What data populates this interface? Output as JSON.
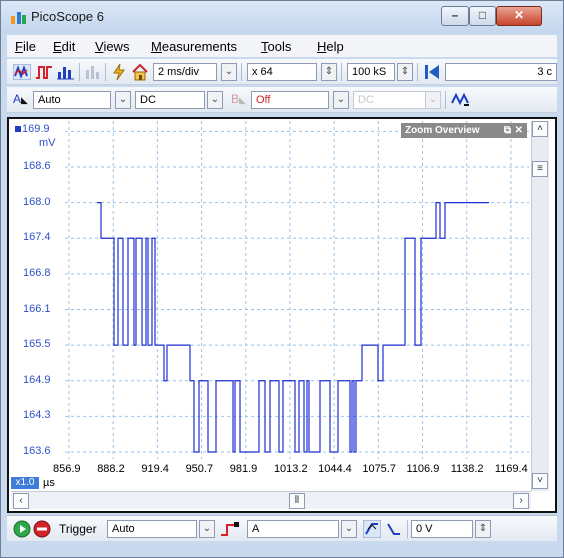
{
  "window": {
    "title": "PicoScope 6"
  },
  "menu": [
    {
      "label": "File",
      "key": "F",
      "rest": "ile"
    },
    {
      "label": "Edit",
      "key": "E",
      "rest": "dit"
    },
    {
      "label": "Views",
      "key": "V",
      "rest": "iews"
    },
    {
      "label": "Measurements",
      "key": "M",
      "rest": "easurements"
    },
    {
      "label": "Tools",
      "key": "T",
      "rest": "ools"
    },
    {
      "label": "Help",
      "key": "H",
      "rest": "elp"
    }
  ],
  "toolbar1": {
    "timebase": "2 ms/div",
    "zoom": "x 64",
    "samples": "100 kS",
    "capture_count": "3 c"
  },
  "toolbar2": {
    "channel_a_label": "A",
    "channel_a_range": "Auto",
    "channel_a_coupling": "DC",
    "channel_b_label": "B",
    "channel_b_range": "Off",
    "channel_b_coupling": "DC"
  },
  "scope": {
    "zoom_overview_label": "Zoom Overview",
    "y_unit": "mV",
    "y_top": "169.9",
    "y_ticks": [
      "168.6",
      "168.0",
      "167.4",
      "166.8",
      "166.1",
      "165.5",
      "164.9",
      "164.3",
      "163.6"
    ],
    "x_ticks": [
      "856.9",
      "888.2",
      "919.4",
      "950.7",
      "981.9",
      "1013.2",
      "1044.4",
      "1075.7",
      "1106.9",
      "1138.2",
      "1169.4"
    ],
    "x_zoom": "x1.0",
    "x_unit": "µs",
    "trace_color": "#1f2fd1"
  },
  "status": {
    "trigger_label": "Trigger",
    "trigger_mode": "Auto",
    "trigger_channel": "A",
    "threshold": "0 V"
  }
}
